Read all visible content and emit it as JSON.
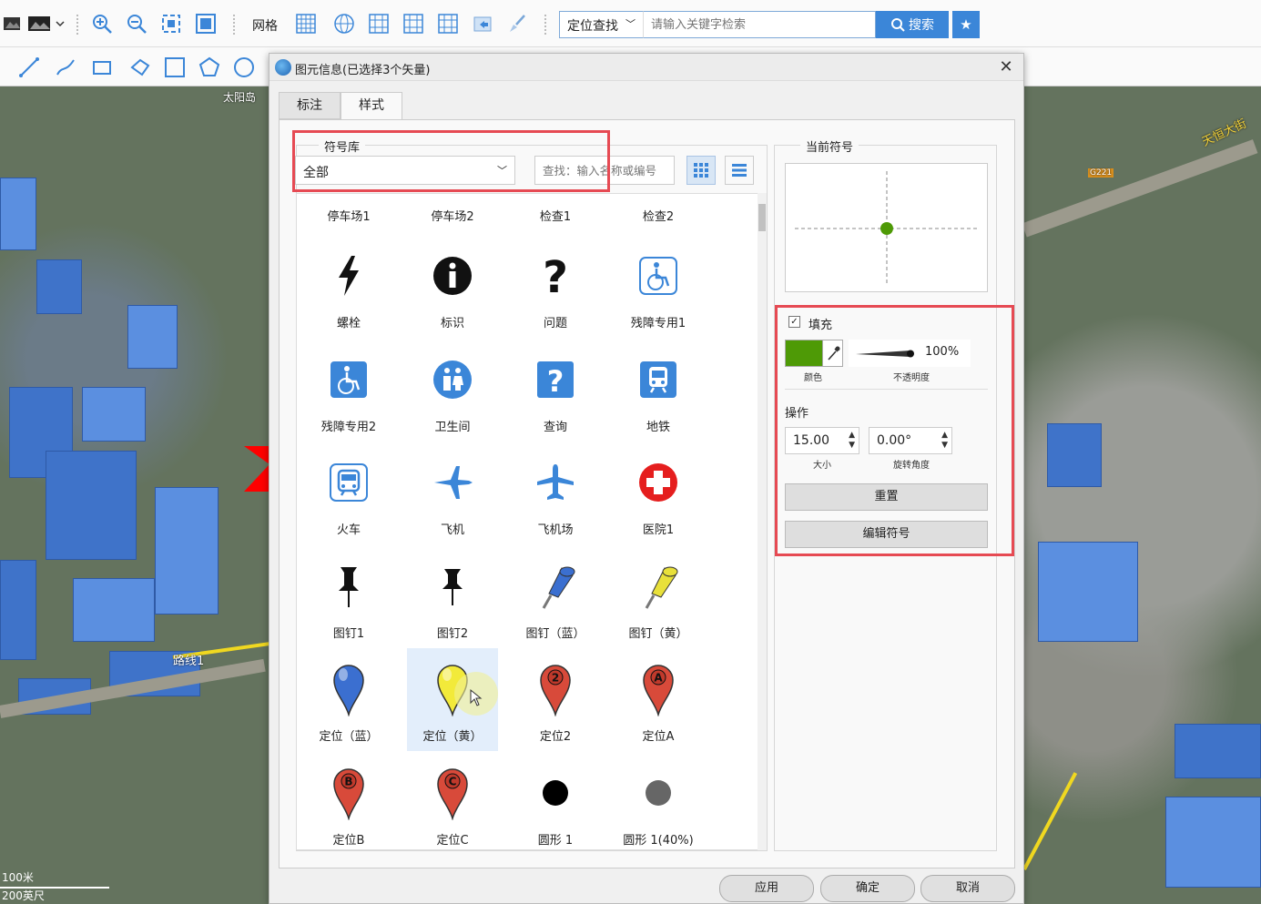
{
  "toolbar": {
    "grid_label": "网格",
    "locate_mode": "定位查找",
    "search_placeholder": "请输入关键字检索",
    "search_label": "搜索"
  },
  "map": {
    "labels": [
      "太阳岛",
      "路线1",
      "天恒大街",
      "G221"
    ],
    "scale": [
      "100米",
      "200英尺"
    ]
  },
  "dialog": {
    "title": "图元信息(已选择3个矢量)",
    "tabs": [
      {
        "label": "标注"
      },
      {
        "label": "样式"
      }
    ],
    "library_title": "符号库",
    "library_value": "全部",
    "find_placeholder": "查找：输入名称或编号",
    "header_row": [
      "停车场1",
      "停车场2",
      "检查1",
      "检查2"
    ],
    "symbols": [
      {
        "label": "螺栓",
        "icon": "bolt-icon"
      },
      {
        "label": "标识",
        "icon": "info-icon"
      },
      {
        "label": "问题",
        "icon": "question-icon"
      },
      {
        "label": "残障专用1",
        "icon": "wheelchair-outline-icon"
      },
      {
        "label": "残障专用2",
        "icon": "wheelchair-icon"
      },
      {
        "label": "卫生间",
        "icon": "restroom-icon"
      },
      {
        "label": "查询",
        "icon": "query-icon"
      },
      {
        "label": "地铁",
        "icon": "subway-icon"
      },
      {
        "label": "火车",
        "icon": "train-icon"
      },
      {
        "label": "飞机",
        "icon": "airplane-icon"
      },
      {
        "label": "飞机场",
        "icon": "airport-icon"
      },
      {
        "label": "医院1",
        "icon": "hospital-icon"
      },
      {
        "label": "图钉1",
        "icon": "pushpin-black-icon"
      },
      {
        "label": "图钉2",
        "icon": "pushpin-black2-icon"
      },
      {
        "label": "图钉（蓝）",
        "icon": "pushpin-blue-icon"
      },
      {
        "label": "图钉（黄）",
        "icon": "pushpin-yellow-icon"
      },
      {
        "label": "定位（蓝）",
        "icon": "pin-blue-icon"
      },
      {
        "label": "定位（黄）",
        "icon": "pin-yellow-icon"
      },
      {
        "label": "定位2",
        "icon": "pin-2-icon",
        "badge": "2"
      },
      {
        "label": "定位A",
        "icon": "pin-a-icon",
        "badge": "A"
      },
      {
        "label": "定位B",
        "icon": "pin-b-icon",
        "badge": "B"
      },
      {
        "label": "定位C",
        "icon": "pin-c-icon",
        "badge": "C"
      },
      {
        "label": "圆形 1",
        "icon": "circle-icon"
      },
      {
        "label": "圆形 1(40%)",
        "icon": "circle-40-icon"
      }
    ],
    "selected_symbol": "定位（黄）",
    "current_symbol_title": "当前符号",
    "fill_label": "填充",
    "fill_checked": true,
    "fill_color": "#4e9a06",
    "color_caption": "颜色",
    "opacity_value": "100%",
    "opacity_caption": "不透明度",
    "operation_title": "操作",
    "size_value": "15.00",
    "size_caption": "大小",
    "rotation_value": "0.00°",
    "rotation_caption": "旋转角度",
    "reset_label": "重置",
    "edit_label": "编辑符号",
    "apply_label": "应用",
    "ok_label": "确定",
    "cancel_label": "取消"
  }
}
